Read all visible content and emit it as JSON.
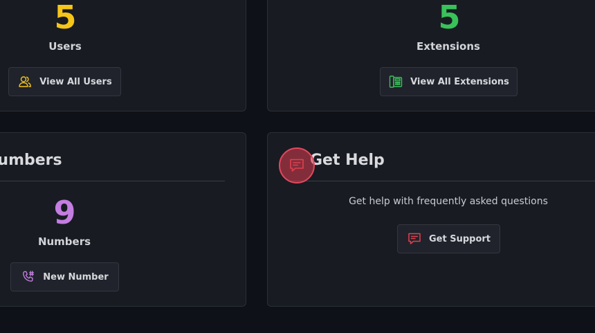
{
  "users_card": {
    "count": "5",
    "label": "Users",
    "button_label": "View All Users",
    "accent": "#f5c518"
  },
  "extensions_card": {
    "count": "5",
    "label": "Extensions",
    "button_label": "View All Extensions",
    "accent": "#39c15a"
  },
  "numbers_card": {
    "title": "Numbers",
    "count": "9",
    "label": "Numbers",
    "button_label": "New Number",
    "accent": "#c47de0"
  },
  "help_card": {
    "title": "Get Help",
    "description": "Get help with frequently asked questions",
    "button_label": "Get Support",
    "accent": "#e0404f"
  },
  "icons": {
    "users": "users-icon",
    "extensions": "desk-phone-icon",
    "numbers": "phone-hash-icon",
    "help": "chat-message-icon"
  }
}
